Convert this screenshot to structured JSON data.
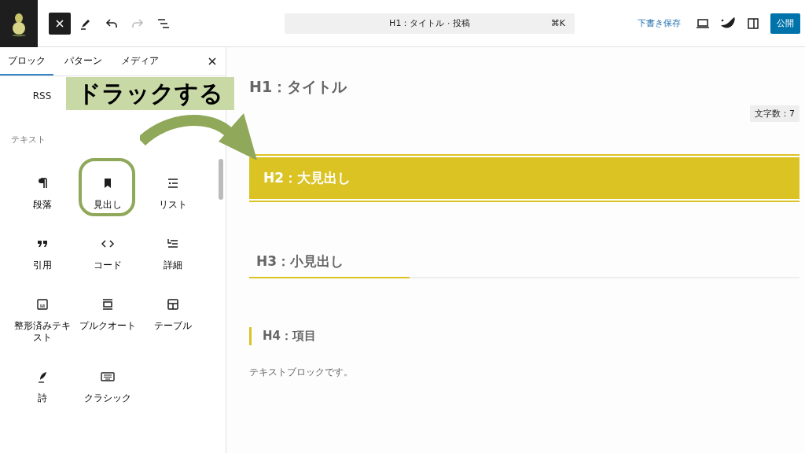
{
  "toolbar": {
    "tools": [
      {
        "kind": "close",
        "disabled": false
      },
      {
        "kind": "edit",
        "disabled": false
      },
      {
        "kind": "undo",
        "disabled": false
      },
      {
        "kind": "redo",
        "disabled": true
      },
      {
        "kind": "outline",
        "disabled": false
      }
    ],
    "command_bar": {
      "title": "H1：タイトル · 投稿",
      "shortcut": "⌘K"
    },
    "save_draft": "下書き保存",
    "publish": "公開"
  },
  "sidebar": {
    "tabs": [
      {
        "label": "ブロック",
        "selected": true
      },
      {
        "label": "パターン",
        "selected": false
      },
      {
        "label": "メディア",
        "selected": false
      }
    ],
    "previous_item": "RSS",
    "section": "テキスト",
    "blocks": [
      {
        "kind": "paragraph",
        "label": "段落",
        "highlighted": false
      },
      {
        "kind": "heading",
        "label": "見出し",
        "highlighted": true
      },
      {
        "kind": "list",
        "label": "リスト",
        "highlighted": false
      },
      {
        "kind": "quote",
        "label": "引用",
        "highlighted": false
      },
      {
        "kind": "code",
        "label": "コード",
        "highlighted": false
      },
      {
        "kind": "details",
        "label": "詳細",
        "highlighted": false
      },
      {
        "kind": "preformatted",
        "label": "整形済みテキスト",
        "highlighted": false
      },
      {
        "kind": "pullquote",
        "label": "プルクオート",
        "highlighted": false
      },
      {
        "kind": "table",
        "label": "テーブル",
        "highlighted": false
      },
      {
        "kind": "verse",
        "label": "詩",
        "highlighted": false
      },
      {
        "kind": "classic",
        "label": "クラシック",
        "highlighted": false
      }
    ]
  },
  "annotation": {
    "text": "ドラックする"
  },
  "content": {
    "title": "H1：タイトル",
    "char_count": "文字数：7",
    "blocks": [
      {
        "kind": "h2",
        "text": "H2：大見出し"
      },
      {
        "kind": "h3",
        "text": "H3：小見出し"
      },
      {
        "kind": "h4",
        "text": "H4：項目"
      },
      {
        "kind": "p",
        "text": "テキストブロックです。"
      }
    ]
  }
}
